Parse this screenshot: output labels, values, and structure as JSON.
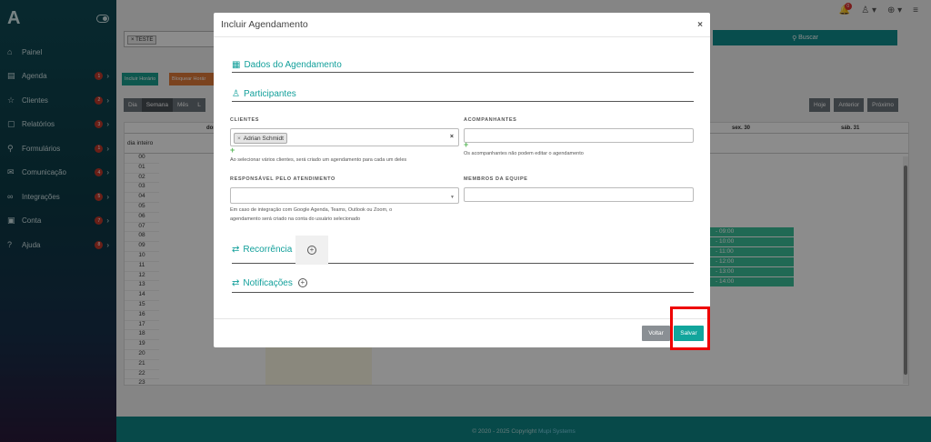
{
  "sidebar": {
    "logo": "A",
    "items": [
      {
        "label": "Painel",
        "icon": "home-icon",
        "badge": ""
      },
      {
        "label": "Agenda",
        "icon": "agenda-icon",
        "badge": "1"
      },
      {
        "label": "Clientes",
        "icon": "star-icon",
        "badge": "2"
      },
      {
        "label": "Relatórios",
        "icon": "report-icon",
        "badge": "3"
      },
      {
        "label": "Formulários",
        "icon": "search-icon",
        "badge": "1"
      },
      {
        "label": "Comunicação",
        "icon": "mail-icon",
        "badge": "4"
      },
      {
        "label": "Integrações",
        "icon": "link-icon",
        "badge": "5"
      },
      {
        "label": "Conta",
        "icon": "bank-icon",
        "badge": "7"
      },
      {
        "label": "Ajuda",
        "icon": "help-icon",
        "badge": "8"
      }
    ]
  },
  "topbar": {
    "notification_count": "0"
  },
  "filters": {
    "chip": "TESTE",
    "buscar_label": "Buscar"
  },
  "toolbar": {
    "incluir_horario": "Incluir Horário",
    "bloquear_horario": "Bloquear Horár"
  },
  "calendar": {
    "views": [
      "Dia",
      "Semana",
      "Mês",
      "L"
    ],
    "active_view": "Semana",
    "nav": [
      "Hoje",
      "Anterior",
      "Próximo"
    ],
    "day_headers": [
      "dom.",
      "sex. 30",
      "sáb. 31"
    ],
    "allday_label": "dia inteiro",
    "hours": [
      "00",
      "01",
      "02",
      "03",
      "04",
      "05",
      "06",
      "07",
      "08",
      "09",
      "10",
      "11",
      "12",
      "13",
      "14",
      "15",
      "16",
      "17",
      "18",
      "19",
      "20",
      "21",
      "22",
      "23"
    ],
    "events": [
      "- 09:00",
      "- 10:00",
      "- 11:00",
      "- 12:00",
      "- 13:00",
      "- 14:00"
    ]
  },
  "footer": {
    "copyright": "© 2020 - 2025 Copyright",
    "brand": "Mupi Systems"
  },
  "modal": {
    "title": "Incluir Agendamento",
    "close": "×",
    "sections": {
      "dados": "Dados do Agendamento",
      "participantes": "Participantes",
      "recorrencia": "Recorrência",
      "notificacoes": "Notificações"
    },
    "clientes": {
      "label": "CLIENTES",
      "selected": "Adrian Schmidt",
      "hint": "Ao selecionar vários clientes, será criado um agendamento para cada um deles"
    },
    "acompanhantes": {
      "label": "ACOMPANHANTES",
      "hint": "Os acompanhantes não podem editar o agendamento"
    },
    "responsavel": {
      "label": "RESPONSÁVEL PELO ATENDIMENTO",
      "hint_line1": "Em caso de integração com Google Agenda, Teams, Outlook ou Zoom, o",
      "hint_line2": "agendamento será criado na conta do usuário selecionado"
    },
    "membros": {
      "label": "MEMBROS DA EQUIPE"
    },
    "buttons": {
      "voltar": "Voltar",
      "salvar": "Salvar"
    }
  },
  "colors": {
    "accent": "#12a59c",
    "highlight": "#ee0000"
  }
}
